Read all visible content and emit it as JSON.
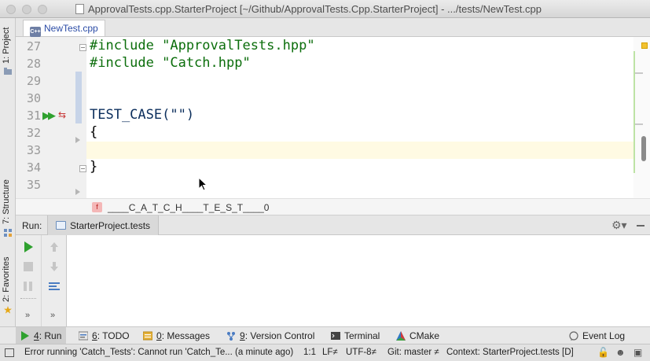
{
  "window": {
    "title": "ApprovalTests.cpp.StarterProject [~/Github/ApprovalTests.Cpp.StarterProject] - .../tests/NewTest.cpp"
  },
  "left_strip": {
    "project_tab": "1: Project",
    "structure_tab": "7: Structure",
    "favorites_tab": "2: Favorites"
  },
  "editor": {
    "tab_label": "NewTest.cpp",
    "tab_icon": "cpp-file-icon",
    "lines": [
      {
        "number": "27",
        "text": "#include \"ApprovalTests.hpp\""
      },
      {
        "number": "28",
        "text": "#include \"Catch.hpp\""
      },
      {
        "number": "29",
        "text": ""
      },
      {
        "number": "30",
        "text": ""
      },
      {
        "number": "31",
        "text": "TEST_CASE(\"\")"
      },
      {
        "number": "32",
        "text": "{"
      },
      {
        "number": "33",
        "text": ""
      },
      {
        "number": "34",
        "text": "}"
      },
      {
        "number": "35",
        "text": ""
      }
    ],
    "breadcrumb_badge": "f",
    "breadcrumb": "____C_A_T_C_H____T_E_S_T____0"
  },
  "run_panel": {
    "label": "Run:",
    "tab_label": "StarterProject.tests",
    "settings_icon": "gear-icon"
  },
  "bottom_tools": [
    {
      "key": "4",
      "label": ": Run",
      "icon": "play-icon"
    },
    {
      "key": "6",
      "label": ": TODO",
      "icon": "todo-icon"
    },
    {
      "key": "0",
      "label": ": Messages",
      "icon": "messages-icon"
    },
    {
      "key": "9",
      "label": ": Version Control",
      "icon": "vcs-icon"
    },
    {
      "key": "",
      "label": "Terminal",
      "icon": "terminal-icon"
    },
    {
      "key": "",
      "label": "CMake",
      "icon": "cmake-icon"
    },
    {
      "key": "",
      "label": "Event Log",
      "icon": "event-log-icon"
    }
  ],
  "status_bar": {
    "message": "Error running 'Catch_Tests': Cannot run 'Catch_Te... (a minute ago)",
    "position": "1:1",
    "line_sep": "LF≠",
    "encoding": "UTF-8≠",
    "git": "Git: master ≠",
    "context": "Context: StarterProject.tests [D]"
  },
  "colors": {
    "run_green": "#2fa12f",
    "caret_line": "#fffae3",
    "string_green": "#067d17"
  }
}
